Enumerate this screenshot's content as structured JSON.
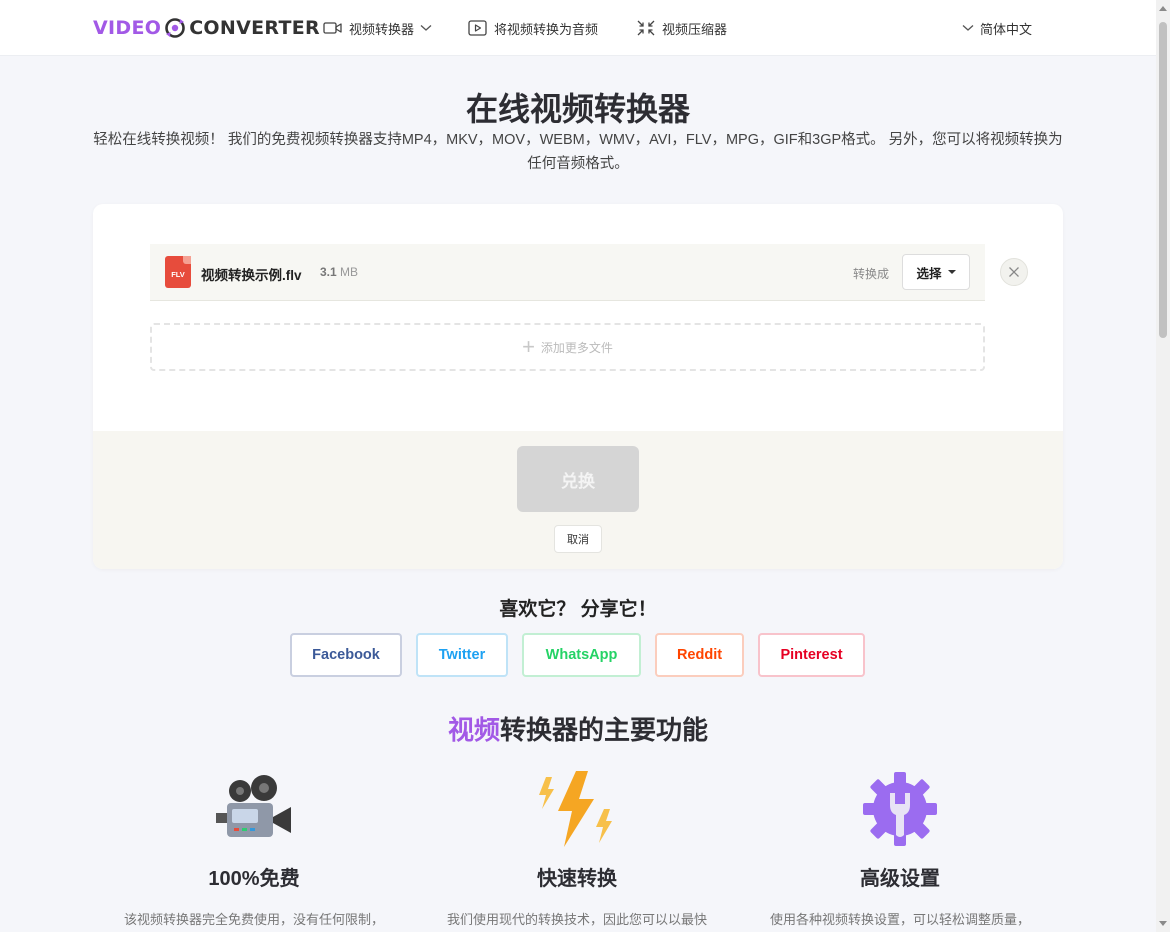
{
  "header": {
    "logo_video": "VIDEO",
    "logo_converter": "CONVERTER",
    "nav": [
      {
        "label": "视频转换器",
        "icon": "video-camera-icon"
      },
      {
        "label": "将视频转换为音频",
        "icon": "play-square-icon"
      },
      {
        "label": "视频压缩器",
        "icon": "compress-icon"
      }
    ],
    "language": "简体中文"
  },
  "hero": {
    "title": "在线视频转换器",
    "description": "轻松在线转换视频！ 我们的免费视频转换器支持MP4，MKV，MOV，WEBM，WMV，AVI，FLV，MPG，GIF和3GP格式。 另外，您可以将视频转换为任何音频格式。"
  },
  "converter": {
    "file": {
      "type_badge": "FLV",
      "name": "视频转换示例.flv",
      "size_value": "3.1",
      "size_unit": "MB"
    },
    "convert_to_label": "转换成",
    "select_label": "选择",
    "add_more_label": "添加更多文件",
    "convert_button": "兑换",
    "cancel_button": "取消"
  },
  "share": {
    "title": "喜欢它？ 分享它！",
    "buttons": [
      {
        "label": "Facebook",
        "color": "#3b5998",
        "border": "#c9cfe0"
      },
      {
        "label": "Twitter",
        "color": "#1da1f2",
        "border": "#bfe3f7"
      },
      {
        "label": "WhatsApp",
        "color": "#25d366",
        "border": "#c2efd3"
      },
      {
        "label": "Reddit",
        "color": "#ff4500",
        "border": "#fbcdbd"
      },
      {
        "label": "Pinterest",
        "color": "#e60023",
        "border": "#f8c3cb"
      }
    ]
  },
  "features": {
    "title_accent": "视频",
    "title_rest": "转换器的主要功能",
    "items": [
      {
        "title": "100%免费",
        "desc": "该视频转换器完全免费使用，没有任何限制，",
        "icon": "movie-camera-icon"
      },
      {
        "title": "快速转换",
        "desc": "我们使用现代的转换技术，因此您可以以最快",
        "icon": "lightning-icon"
      },
      {
        "title": "高级设置",
        "desc": "使用各种视频转换设置，可以轻松调整质量，",
        "icon": "settings-gear-icon"
      }
    ]
  },
  "colors": {
    "brand": "#a259e6",
    "file_badge": "#e74c3c",
    "convert_disabled": "#d5d5d5"
  }
}
